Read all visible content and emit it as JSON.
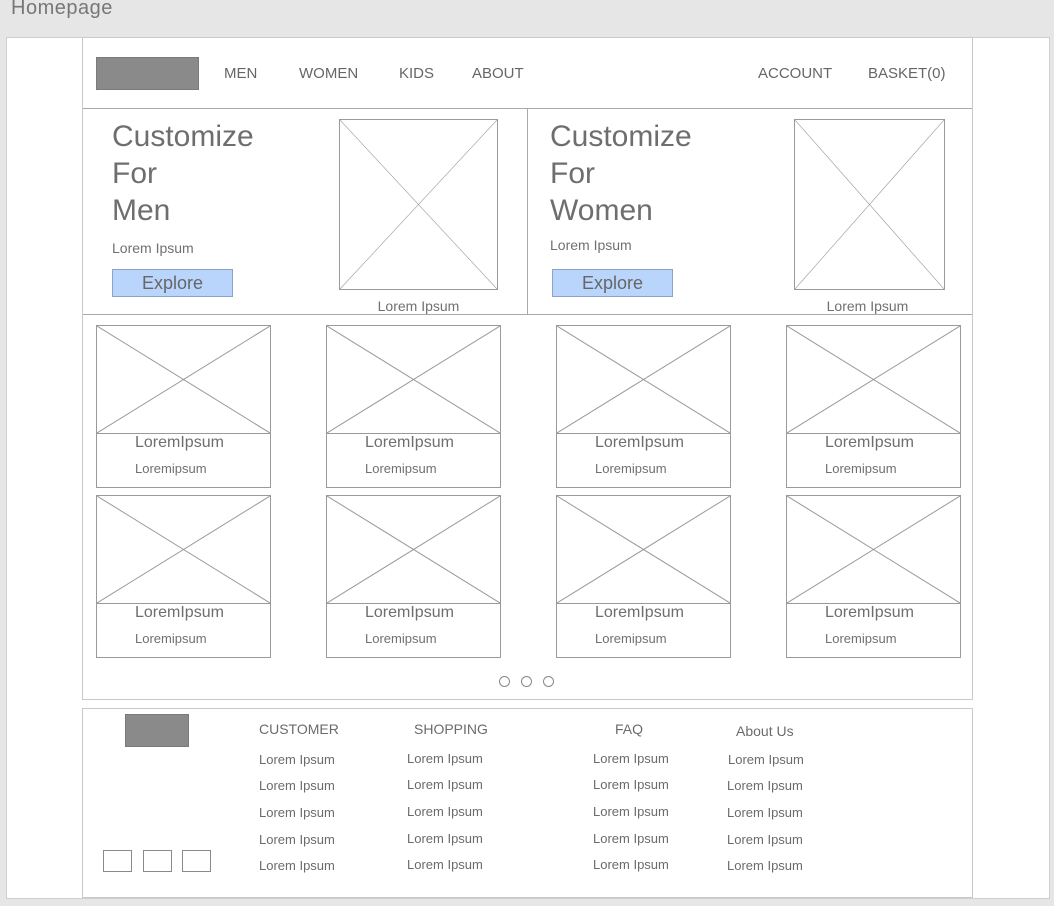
{
  "page_title": "Homepage",
  "header": {
    "nav": [
      "MEN",
      "WOMEN",
      "KIDS",
      "ABOUT"
    ],
    "account": "ACCOUNT",
    "basket": "BASKET(0)"
  },
  "hero": [
    {
      "title_lines": [
        "Customize",
        "For",
        "Men"
      ],
      "subtitle": "Lorem Ipsum",
      "button": "Explore",
      "image_caption": "Lorem Ipsum"
    },
    {
      "title_lines": [
        "Customize",
        "For",
        "Women"
      ],
      "subtitle": "Lorem Ipsum",
      "button": "Explore",
      "image_caption": "Lorem Ipsum"
    }
  ],
  "products": [
    {
      "title": "LoremIpsum",
      "subtitle": "Loremipsum"
    },
    {
      "title": "LoremIpsum",
      "subtitle": "Loremipsum"
    },
    {
      "title": "LoremIpsum",
      "subtitle": "Loremipsum"
    },
    {
      "title": "LoremIpsum",
      "subtitle": "Loremipsum"
    },
    {
      "title": "LoremIpsum",
      "subtitle": "Loremipsum"
    },
    {
      "title": "LoremIpsum",
      "subtitle": "Loremipsum"
    },
    {
      "title": "LoremIpsum",
      "subtitle": "Loremipsum"
    },
    {
      "title": "LoremIpsum",
      "subtitle": "Loremipsum"
    }
  ],
  "pagination": {
    "pages": 3
  },
  "footer": {
    "columns": [
      {
        "heading": "CUSTOMER",
        "links": [
          "Lorem Ipsum",
          "Lorem Ipsum",
          "Lorem Ipsum",
          "Lorem Ipsum",
          "Lorem Ipsum"
        ]
      },
      {
        "heading": "SHOPPING",
        "links": [
          "Lorem Ipsum",
          "Lorem Ipsum",
          "Lorem Ipsum",
          "Lorem Ipsum",
          "Lorem Ipsum"
        ]
      },
      {
        "heading": "FAQ",
        "links": [
          "Lorem Ipsum",
          "Lorem Ipsum",
          "Lorem Ipsum",
          "Lorem Ipsum",
          "Lorem Ipsum"
        ]
      },
      {
        "heading": "About Us",
        "links": [
          "Lorem Ipsum",
          "Lorem Ipsum",
          "Lorem Ipsum",
          "Lorem Ipsum",
          "Lorem Ipsum"
        ]
      }
    ],
    "social_icons": [
      "social-icon",
      "social-icon",
      "social-icon"
    ]
  }
}
